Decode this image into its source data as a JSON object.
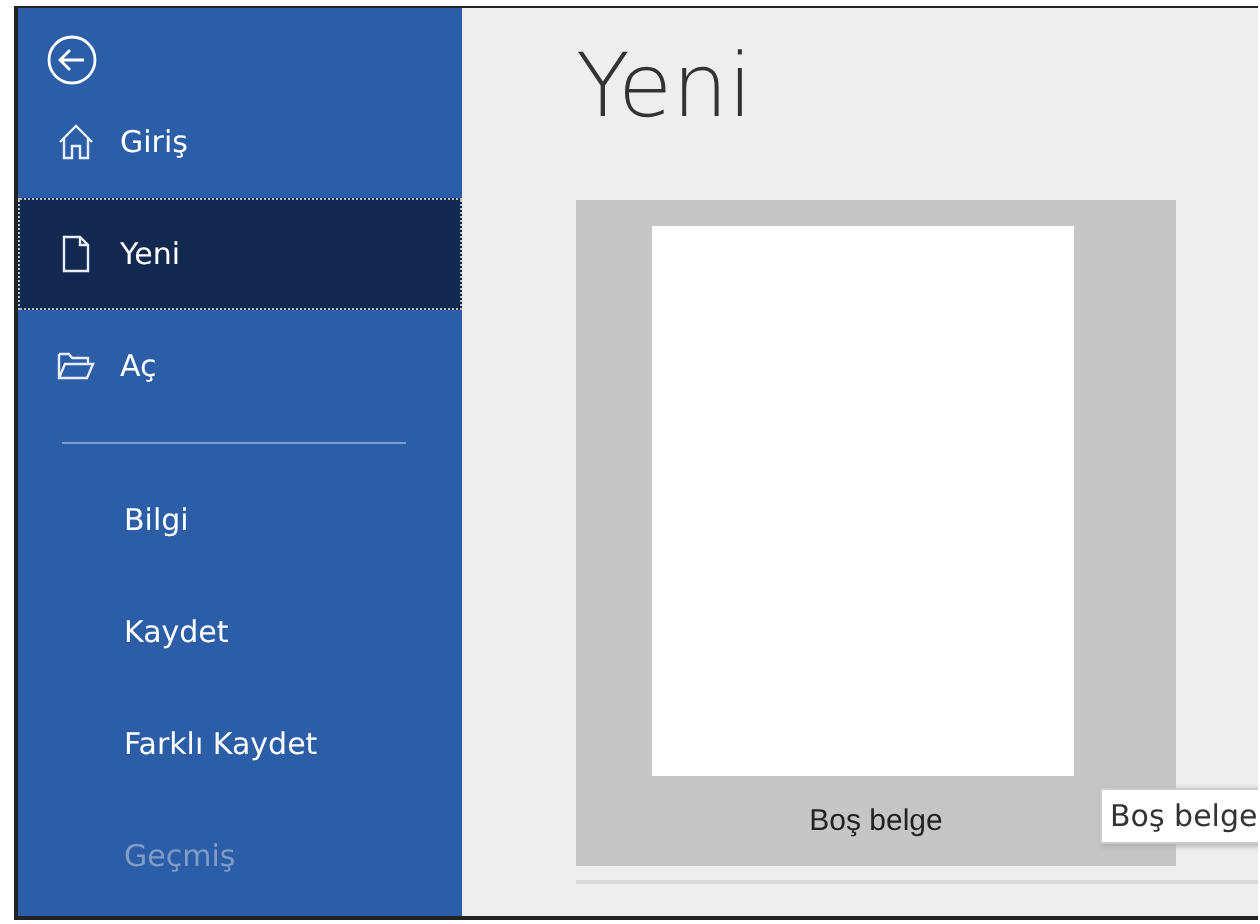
{
  "sidebar": {
    "items": [
      {
        "label": "Giriş",
        "kind": "icon",
        "selected": false,
        "disabled": false
      },
      {
        "label": "Yeni",
        "kind": "icon",
        "selected": true,
        "disabled": false
      },
      {
        "label": "Aç",
        "kind": "icon",
        "selected": false,
        "disabled": false
      },
      {
        "kind": "divider"
      },
      {
        "label": "Bilgi",
        "kind": "plain",
        "selected": false,
        "disabled": false
      },
      {
        "label": "Kaydet",
        "kind": "plain",
        "selected": false,
        "disabled": false
      },
      {
        "label": "Farklı Kaydet",
        "kind": "plain",
        "selected": false,
        "disabled": false
      },
      {
        "label": "Geçmiş",
        "kind": "plain",
        "selected": false,
        "disabled": true
      }
    ]
  },
  "main": {
    "title": "Yeni",
    "templates": [
      {
        "label": "Boş belge",
        "tooltip": "Boş belge"
      }
    ]
  }
}
